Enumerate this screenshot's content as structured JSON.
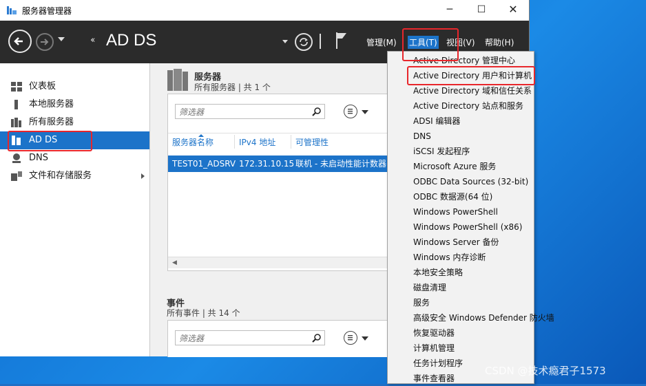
{
  "window": {
    "title": "服务器管理器",
    "controls": {
      "minimize": "─",
      "maximize": "☐",
      "close": "✕"
    }
  },
  "nav": {
    "breadcrumb_arrows": "‹‹",
    "page_title": "AD DS",
    "menus": {
      "manage": "管理(M)",
      "tools": "工具(T)",
      "view": "视图(V)",
      "help": "帮助(H)"
    }
  },
  "sidebar": {
    "items": [
      {
        "label": "仪表板",
        "icon": "dashboard-icon"
      },
      {
        "label": "本地服务器",
        "icon": "local-server-icon"
      },
      {
        "label": "所有服务器",
        "icon": "all-servers-icon"
      },
      {
        "label": "AD DS",
        "icon": "ad-ds-icon",
        "active": true
      },
      {
        "label": "DNS",
        "icon": "dns-icon"
      },
      {
        "label": "文件和存储服务",
        "icon": "file-storage-icon",
        "has_submenu": true
      }
    ]
  },
  "servers": {
    "title": "服务器",
    "subtitle": "所有服务器 | 共 1 个",
    "filter_placeholder": "筛选器",
    "columns": [
      "服务器名称",
      "IPv4 地址",
      "可管理性"
    ],
    "rows": [
      {
        "name": "TEST01_ADSRV",
        "ipv4": "172.31.10.15",
        "manageability": "联机 - 未启动性能计数器"
      }
    ]
  },
  "events": {
    "title": "事件",
    "subtitle": "所有事件 | 共 14 个",
    "filter_placeholder": "筛选器"
  },
  "tools_menu": {
    "items": [
      "Active Directory 管理中心",
      "Active Directory 用户和计算机",
      "Active Directory 域和信任关系",
      "Active Directory 站点和服务",
      "ADSI 编辑器",
      "DNS",
      "iSCSI 发起程序",
      "Microsoft Azure 服务",
      "ODBC Data Sources (32-bit)",
      "ODBC 数据源(64 位)",
      "Windows PowerShell",
      "Windows PowerShell (x86)",
      "Windows Server 备份",
      "Windows 内存诊断",
      "本地安全策略",
      "磁盘清理",
      "服务",
      "高级安全 Windows Defender 防火墙",
      "恢复驱动器",
      "计算机管理",
      "任务计划程序",
      "事件查看器"
    ],
    "highlighted_index": 1
  },
  "watermark": "CSDN @技术瘾君子1573",
  "colors": {
    "accent": "#1c73c9",
    "nav_bg": "#2b2b2b",
    "annotation": "#e8262b"
  }
}
